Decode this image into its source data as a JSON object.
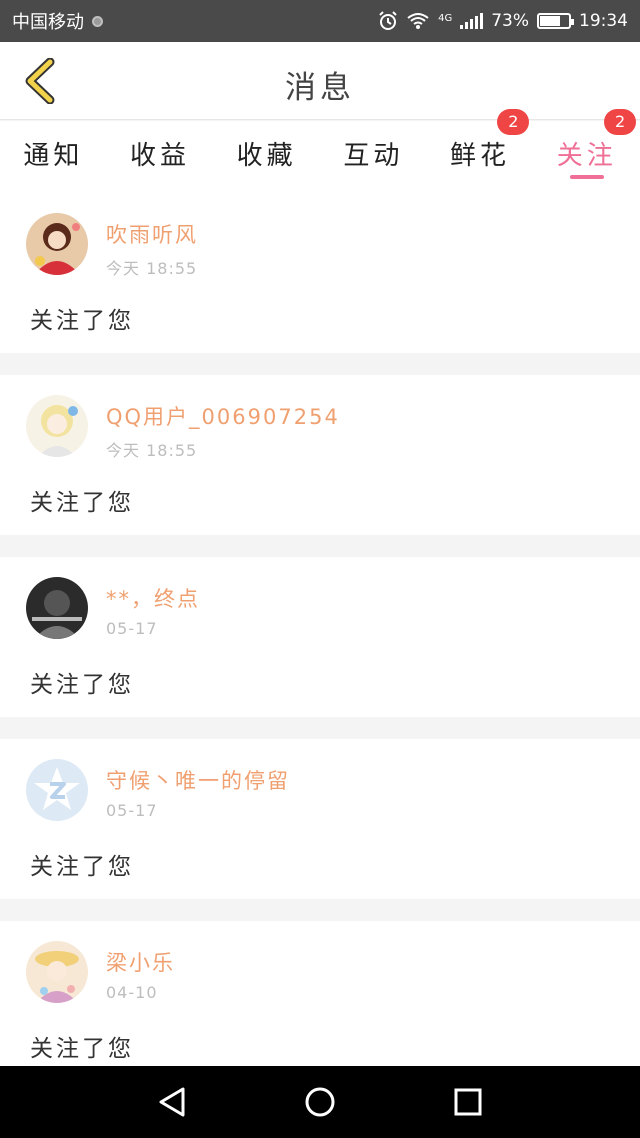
{
  "status_bar": {
    "carrier": "中国移动",
    "network": "4G",
    "battery": "73%",
    "battery_level": 0.73,
    "time": "19:34"
  },
  "header": {
    "title": "消息"
  },
  "tabs": [
    {
      "label": "通知",
      "badge": null,
      "active": false
    },
    {
      "label": "收益",
      "badge": null,
      "active": false
    },
    {
      "label": "收藏",
      "badge": null,
      "active": false
    },
    {
      "label": "互动",
      "badge": null,
      "active": false
    },
    {
      "label": "鲜花",
      "badge": "2",
      "active": false
    },
    {
      "label": "关注",
      "badge": "2",
      "active": true
    }
  ],
  "messages": [
    {
      "username": "吹雨听风",
      "time": "今天 18:55",
      "action": "关注了您"
    },
    {
      "username": "QQ用户_006907254",
      "time": "今天 18:55",
      "action": "关注了您"
    },
    {
      "username": "**，终点",
      "time": "05-17",
      "action": "关注了您"
    },
    {
      "username": "守候丶唯一的停留",
      "time": "05-17",
      "action": "关注了您"
    },
    {
      "username": "梁小乐",
      "time": "04-10",
      "action": "关注了您"
    }
  ],
  "colors": {
    "accent": "#ef6f96",
    "username": "#f0a070",
    "badge": "#f04545",
    "back_arrow": "#f2d24a"
  }
}
